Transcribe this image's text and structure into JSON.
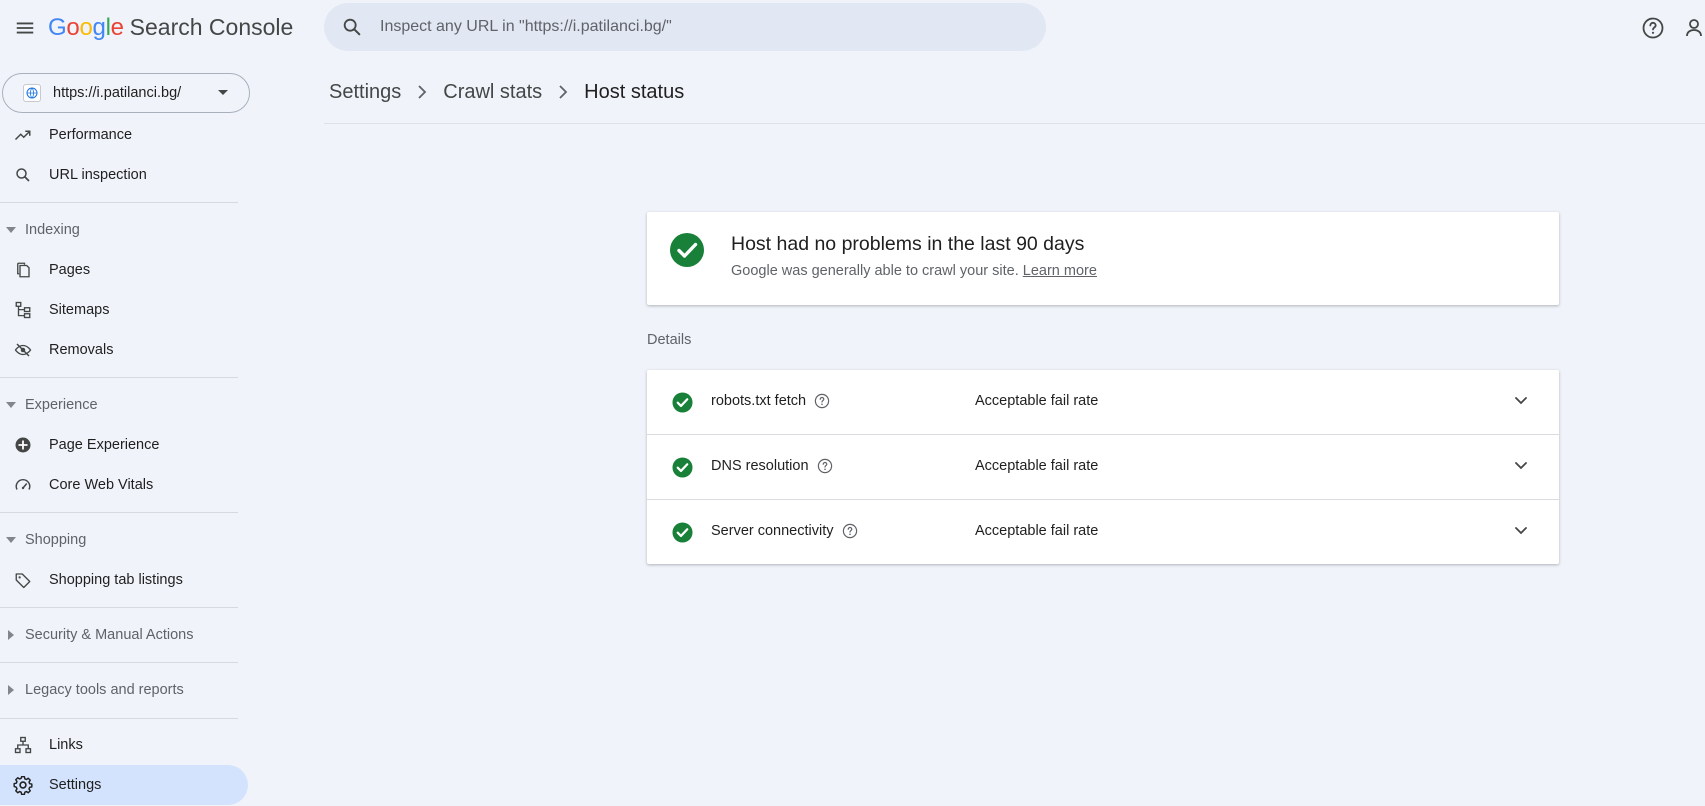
{
  "app": {
    "logo_letters": [
      {
        "char": "G",
        "color": "#4285F4"
      },
      {
        "char": "o",
        "color": "#EA4335"
      },
      {
        "char": "o",
        "color": "#FBBC05"
      },
      {
        "char": "g",
        "color": "#4285F4"
      },
      {
        "char": "l",
        "color": "#34A853"
      },
      {
        "char": "e",
        "color": "#EA4335"
      }
    ],
    "product_name": "Search Console",
    "icons": {
      "menu": "menu-icon",
      "help": "help-icon",
      "account": "account-icon",
      "search": "search-icon"
    }
  },
  "search": {
    "placeholder": "Inspect any URL in \"https://i.patilanci.bg/\"",
    "value": ""
  },
  "property": {
    "url": "https://i.patilanci.bg/",
    "icon": "globe-icon"
  },
  "sidebar": {
    "performance": "Performance",
    "url_inspection": "URL inspection",
    "indexing": {
      "header": "Indexing",
      "pages": "Pages",
      "sitemaps": "Sitemaps",
      "removals": "Removals"
    },
    "experience": {
      "header": "Experience",
      "page_experience": "Page Experience",
      "core_web_vitals": "Core Web Vitals"
    },
    "shopping": {
      "header": "Shopping",
      "shopping_tab_listings": "Shopping tab listings"
    },
    "security_manual_actions": "Security & Manual Actions",
    "legacy_tools": "Legacy tools and reports",
    "links": "Links",
    "settings": "Settings",
    "active_item": "settings"
  },
  "breadcrumb": {
    "items": [
      "Settings",
      "Crawl stats"
    ],
    "current": "Host status"
  },
  "status": {
    "title": "Host had no problems in the last 90 days",
    "subtitle": "Google was generally able to crawl your site.",
    "learn_more": "Learn more",
    "status_color": "#188038"
  },
  "details": {
    "label": "Details",
    "rows": [
      {
        "name": "robots.txt fetch",
        "status": "Acceptable fail rate"
      },
      {
        "name": "DNS resolution",
        "status": "Acceptable fail rate"
      },
      {
        "name": "Server connectivity",
        "status": "Acceptable fail rate"
      }
    ]
  },
  "colors": {
    "background": "#f0f4fa",
    "search_bg": "#e1e7f3",
    "active_nav_bg": "#d3e3fd",
    "success_green": "#188038"
  }
}
